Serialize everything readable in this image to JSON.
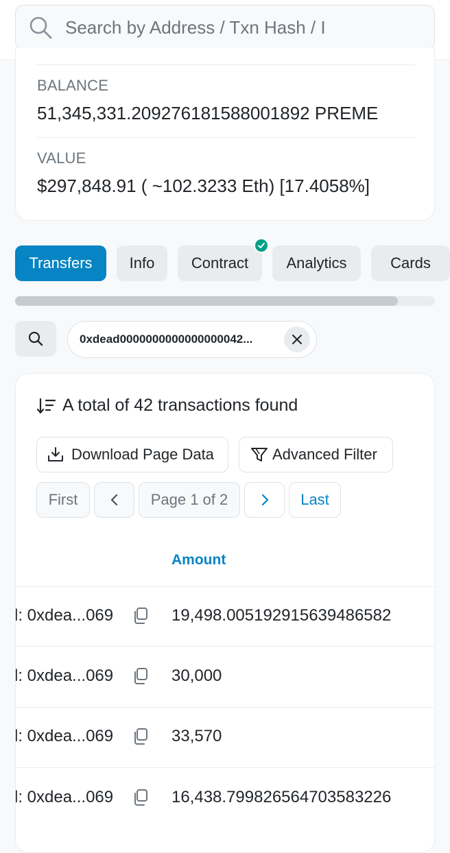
{
  "search": {
    "placeholder": "Search by Address / Txn Hash / I"
  },
  "overview": {
    "balance_label": "BALANCE",
    "balance_value": "51,345,331.209276181588001892 PREME",
    "value_label": "VALUE",
    "value_value": "$297,848.91 ( ~102.3233 Eth) [17.4058%]"
  },
  "tabs": {
    "items": [
      {
        "label": "Transfers",
        "active": true
      },
      {
        "label": "Info",
        "active": false
      },
      {
        "label": "Contract",
        "active": false,
        "verified": true
      },
      {
        "label": "Analytics",
        "active": false
      },
      {
        "label": "Cards",
        "active": false
      }
    ]
  },
  "filter": {
    "chip_text": "0xdead0000000000000000042..."
  },
  "transactions": {
    "summary": "A total of 42 transactions found",
    "download_label": "Download Page Data",
    "advanced_filter_label": "Advanced Filter",
    "pagination": {
      "first": "First",
      "page_info": "Page 1 of 2",
      "last": "Last"
    },
    "amount_header": "Amount",
    "rows": [
      {
        "from": "l: 0xdea...069",
        "amount": "19,498.005192915639486582"
      },
      {
        "from": "l: 0xdea...069",
        "amount": "30,000"
      },
      {
        "from": "l: 0xdea...069",
        "amount": "33,570"
      },
      {
        "from": "l: 0xdea...069",
        "amount": "16,438.799826564703583226"
      }
    ]
  },
  "colors": {
    "accent": "#0784c3",
    "verified": "#00a186",
    "background": "#f8f9fa"
  }
}
